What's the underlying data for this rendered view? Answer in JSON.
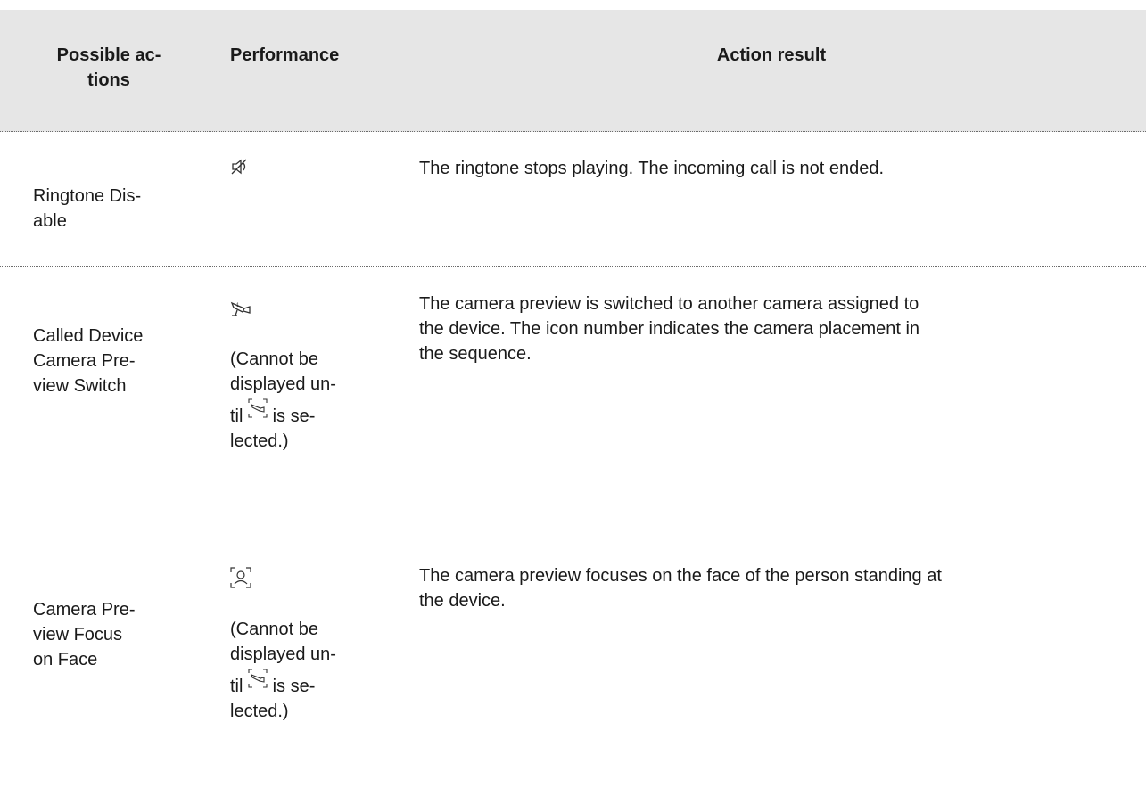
{
  "header": {
    "col_actions": "Possible ac- tions",
    "col_performance": "Performance",
    "col_result": "Action result"
  },
  "rows": [
    {
      "action_line1": "Ringtone Dis-",
      "action_line2": "able",
      "icon": "mute-speaker-icon",
      "note": "",
      "result": "The ringtone stops playing. The incoming call is not ended."
    },
    {
      "action_line1": "Called Device",
      "action_line2": "Camera Pre-",
      "action_line3": "view Switch",
      "icon": "camera-switch-icon",
      "note_l1": "(Cannot be",
      "note_l2": "displayed un-",
      "note_l3a": "til",
      "note_l3b": "is se-",
      "note_l4": "lected.)",
      "note_inline_icon": "camera-preview-icon",
      "result_l1": "The camera preview is switched to another camera assigned to",
      "result_l2": "the device. The icon number indicates the camera placement in",
      "result_l3": "the sequence."
    },
    {
      "action_line1": "Camera Pre-",
      "action_line2": "view Focus",
      "action_line3": "on Face",
      "icon": "face-focus-icon",
      "note_l1": "(Cannot be",
      "note_l2": "displayed un-",
      "note_l3a": "til",
      "note_l3b": "is se-",
      "note_l4": "lected.)",
      "note_inline_icon": "camera-preview-icon",
      "result_l1": "The camera preview focuses on the face of the person standing at",
      "result_l2": "the device."
    }
  ]
}
